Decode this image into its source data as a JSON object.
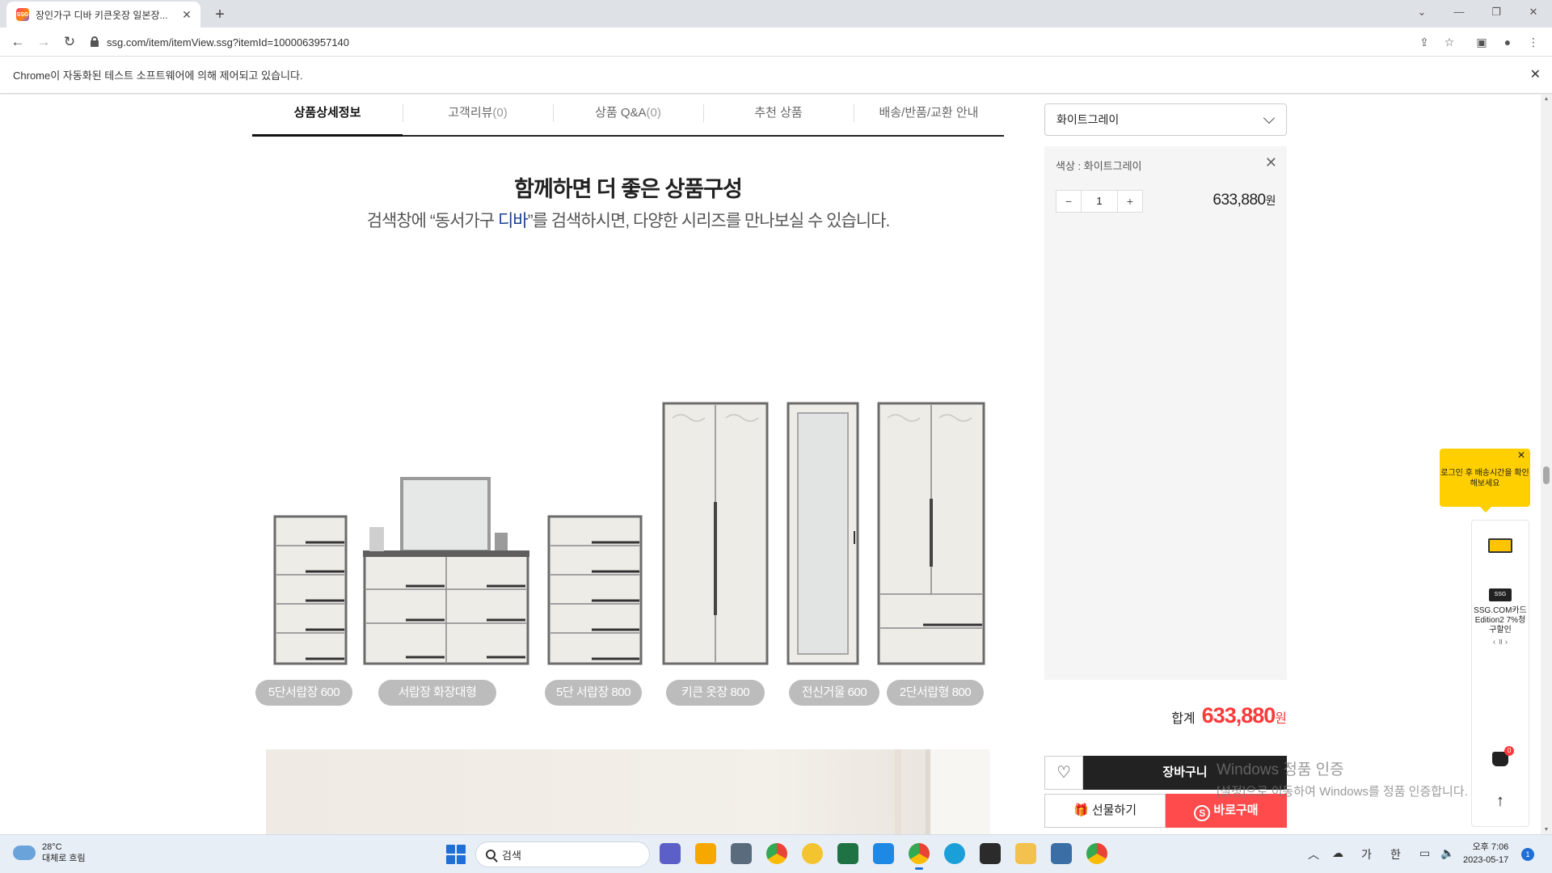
{
  "browser": {
    "tab_title": "장인가구 디바 키큰옷장 일본장...",
    "url": "ssg.com/item/itemView.ssg?itemId=1000063957140",
    "infobar_message": "Chrome이 자동화된 테스트 소프트웨어에 의해 제어되고 있습니다.",
    "favicon_text": "SSG"
  },
  "product_tabs": [
    {
      "label": "상품상세정보",
      "count": ""
    },
    {
      "label": "고객리뷰",
      "count": "(0)"
    },
    {
      "label": "상품 Q&A",
      "count": "(0)"
    },
    {
      "label": "추천 상품",
      "count": ""
    },
    {
      "label": "배송/반품/교환 안내",
      "count": ""
    }
  ],
  "promo": {
    "title": "함께하면 더 좋은 상품구성",
    "subtitle_before": "검색창에 “동서가구 ",
    "subtitle_em": "디바",
    "subtitle_after": "”를 검색하시면, 다양한 시리즈를 만나보실 수 있습니다."
  },
  "furniture_items": [
    "5단서랍장 600",
    "서랍장 화장대형",
    "5단 서랍장 800",
    "키큰 옷장 800",
    "전신거울 600",
    "2단서랍형 800"
  ],
  "order": {
    "selected_option": "화이트그레이",
    "option_label": "색상 : 화이트그레이",
    "quantity": "1",
    "minus": "−",
    "plus": "+",
    "line_price": "633,880",
    "currency": "원",
    "total_label": "합계",
    "total_amount": "633,880"
  },
  "buttons": {
    "cart": "장바구니",
    "gift": "선물하기",
    "buy": "바로구매"
  },
  "watermark": {
    "line1": "Windows 정품 인증",
    "line2": "[설정]으로 이동하여 Windows를 정품 인증합니다."
  },
  "side_widget": {
    "tooltip": "로그인 후 배송시간을 확인해보세요",
    "card_badge": "SSG",
    "card_text": "SSG.COM카드 Edition2 7%청구할인",
    "cart_count": "0"
  },
  "taskbar": {
    "temp": "28°C",
    "weather": "대체로 흐림",
    "search_placeholder": "검색",
    "ime_1": "가",
    "ime_2": "한",
    "time": "오후 7:06",
    "date": "2023-05-17",
    "notifications": "1"
  },
  "colors": {
    "accent_red": "#ff3a3a",
    "buy_red": "#ff4b4b",
    "tooltip_yellow": "#ffcf00",
    "dark_button": "#222222",
    "highlight_blue": "#1d3f8f"
  }
}
